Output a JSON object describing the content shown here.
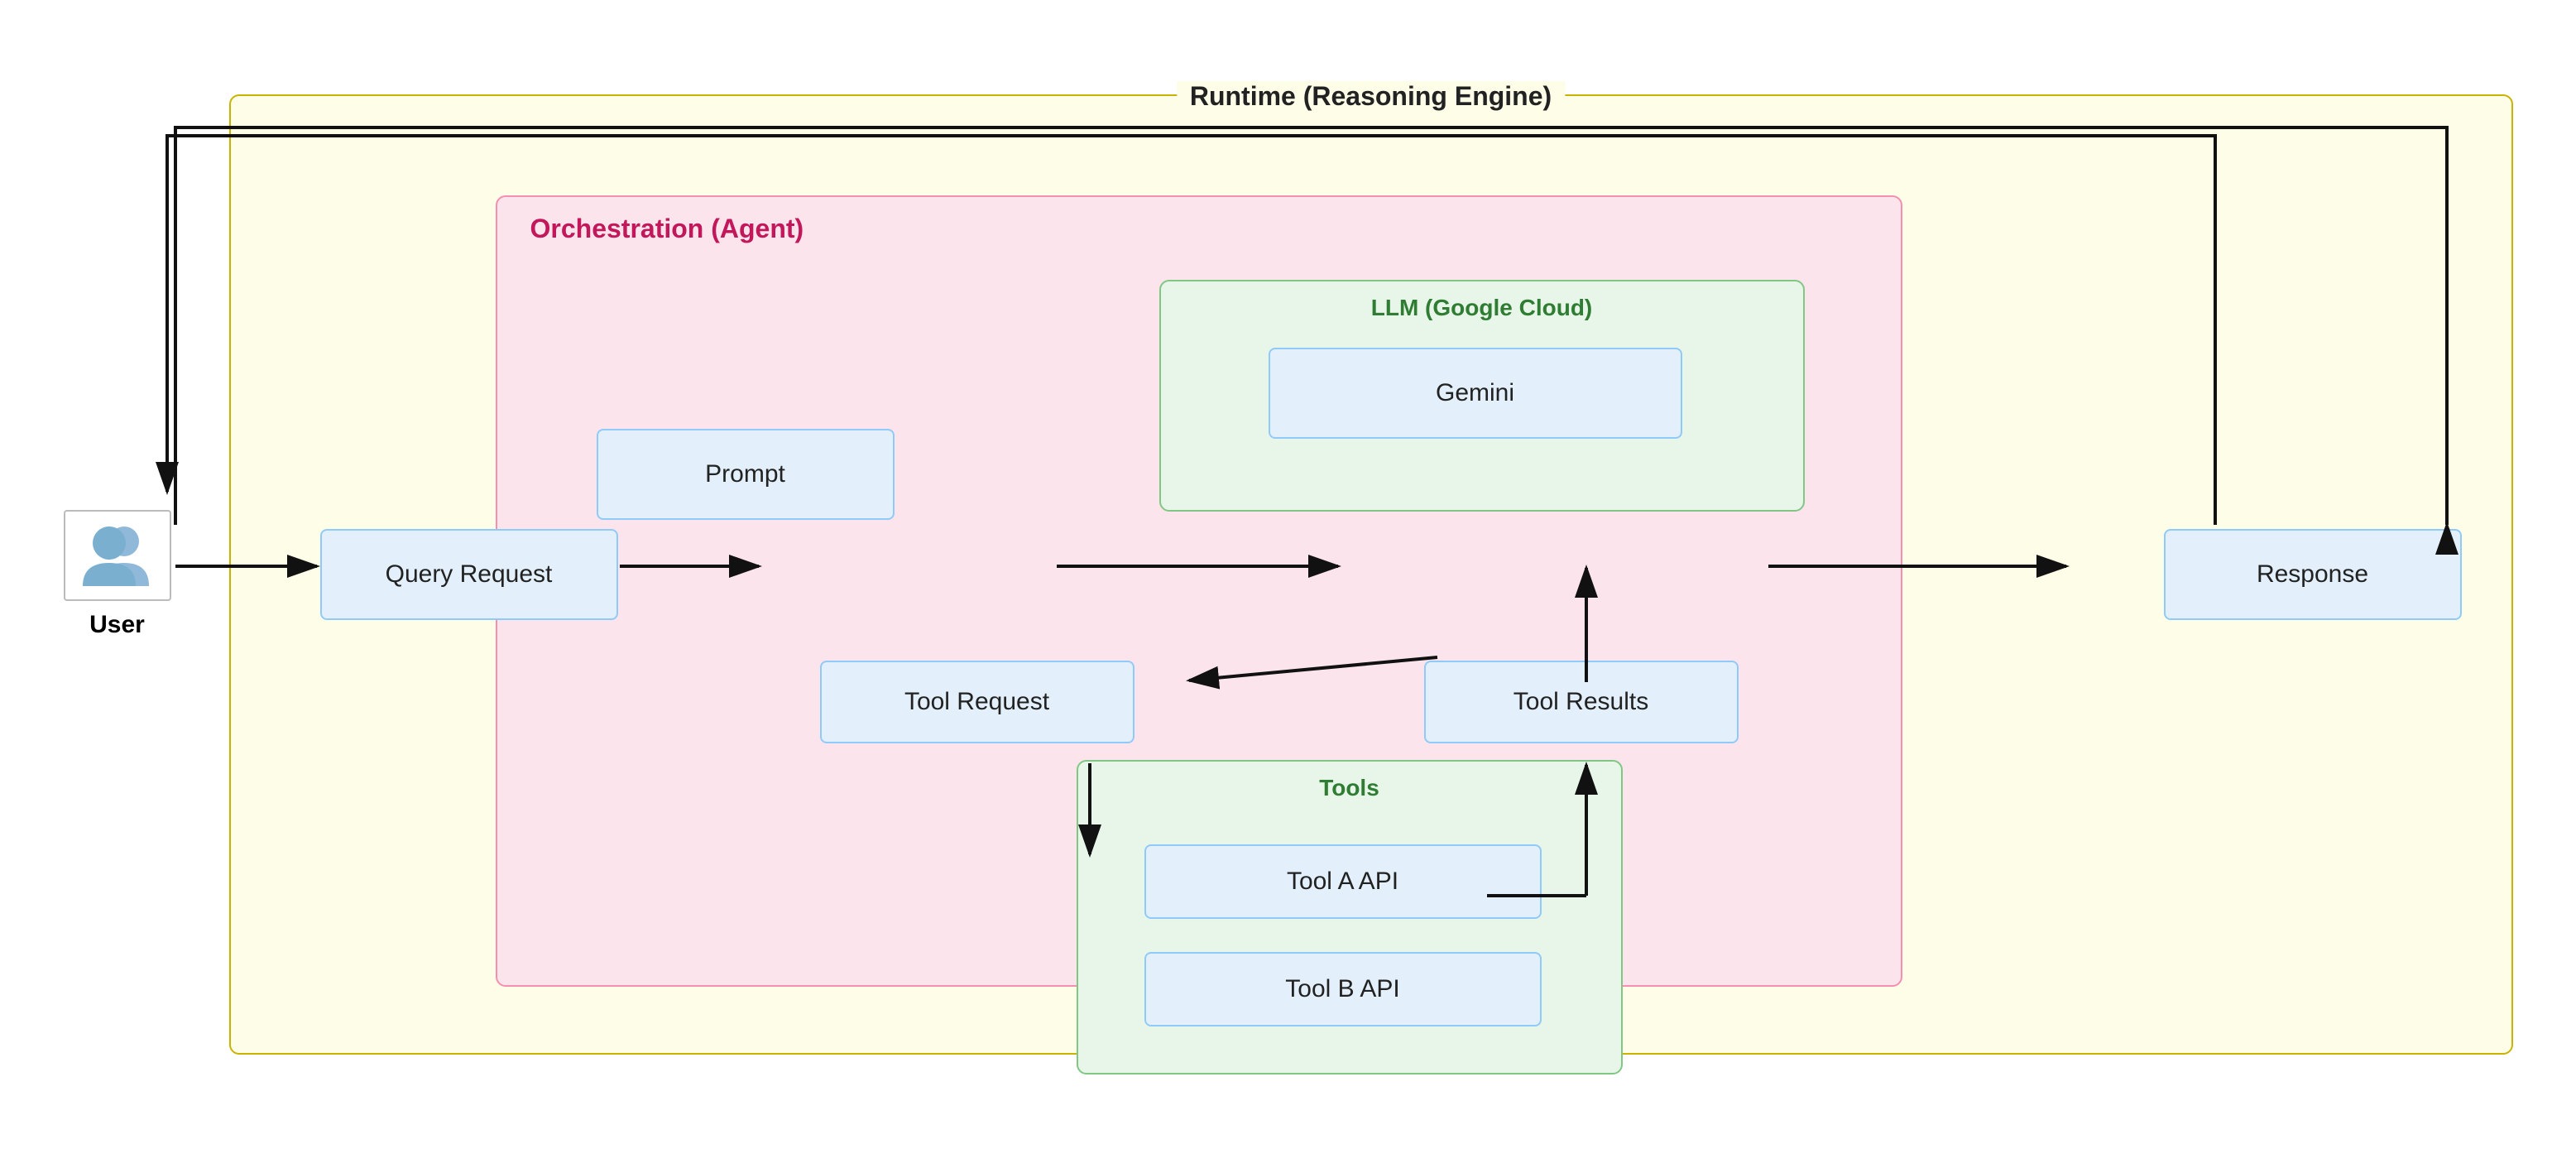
{
  "diagram": {
    "title": "Runtime (Reasoning Engine)",
    "sections": {
      "runtime": {
        "label": "Runtime (Reasoning Engine)"
      },
      "orchestration": {
        "label": "Orchestration (Agent)"
      },
      "llm": {
        "label": "LLM (Google Cloud)"
      },
      "tools": {
        "label": "Tools"
      }
    },
    "boxes": {
      "user": "User",
      "query_request": "Query Request",
      "prompt": "Prompt",
      "gemini": "Gemini",
      "tool_request": "Tool Request",
      "tool_results": "Tool Results",
      "tool_a": "Tool A API",
      "tool_b": "Tool B API",
      "response": "Response"
    }
  }
}
